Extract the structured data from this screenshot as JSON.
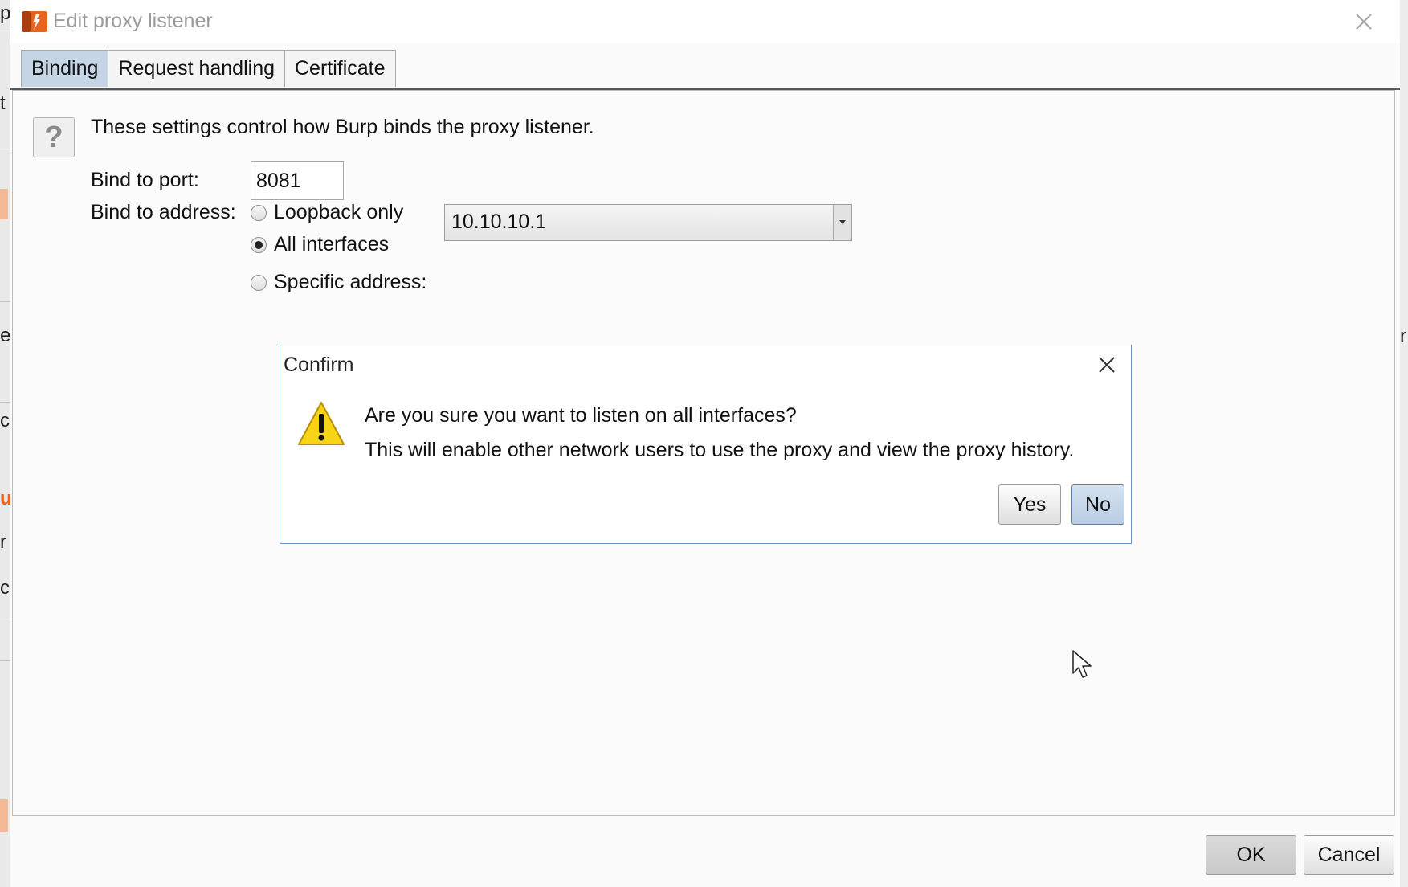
{
  "window": {
    "title": "Edit proxy listener",
    "icon": "burp-logo-icon"
  },
  "tabs": [
    {
      "label": "Binding",
      "active": true
    },
    {
      "label": "Request handling",
      "active": false
    },
    {
      "label": "Certificate",
      "active": false
    }
  ],
  "binding": {
    "help_icon": "?",
    "intro": "These settings control how Burp binds the proxy listener.",
    "port_label": "Bind to port:",
    "port_value": "8081",
    "address_label": "Bind to address:",
    "options": [
      {
        "label": "Loopback only",
        "checked": false
      },
      {
        "label": "All interfaces",
        "checked": true
      },
      {
        "label": "Specific address:",
        "checked": false
      }
    ],
    "specific_address_value": "10.10.10.1"
  },
  "confirm": {
    "title": "Confirm",
    "icon": "warning-icon",
    "message_line1": "Are you sure you want to listen on all interfaces?",
    "message_line2": "This will enable other network users to use the proxy and view the proxy history.",
    "yes_label": "Yes",
    "no_label": "No"
  },
  "footer": {
    "ok_label": "OK",
    "cancel_label": "Cancel"
  },
  "colors": {
    "active_tab": "#c5d5e6",
    "brand_orange": "#e8641e",
    "confirm_border": "#6d95bf"
  }
}
